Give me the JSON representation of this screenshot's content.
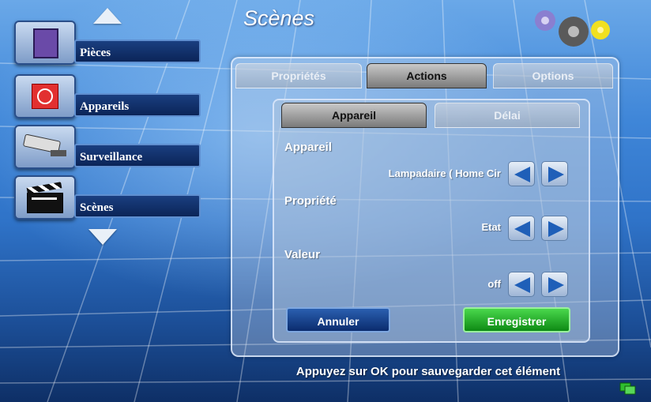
{
  "header": {
    "title": "Scènes"
  },
  "sidebar": {
    "items": [
      {
        "label": "Pièces",
        "icon": "door-icon"
      },
      {
        "label": "Appareils",
        "icon": "power-box-icon"
      },
      {
        "label": "Surveillance",
        "icon": "camera-icon"
      },
      {
        "label": "Scènes",
        "icon": "clapperboard-icon"
      }
    ]
  },
  "panel": {
    "tabs": [
      {
        "label": "Propriétés",
        "active": false
      },
      {
        "label": "Actions",
        "active": true
      },
      {
        "label": "Options",
        "active": false
      }
    ],
    "subtabs": [
      {
        "label": "Appareil",
        "active": true
      },
      {
        "label": "Délai",
        "active": false
      }
    ],
    "fields": [
      {
        "label": "Appareil",
        "value": "Lampadaire ( Home Cir"
      },
      {
        "label": "Propriété",
        "value": "Etat"
      },
      {
        "label": "Valeur",
        "value": "off"
      }
    ],
    "cancel_label": "Annuler",
    "save_label": "Enregistrer"
  },
  "footer": {
    "hint": "Appuyez sur OK pour sauvegarder cet élément"
  },
  "colors": {
    "accent": "#1f5fb8",
    "save": "#1aa51f",
    "cancel": "#0b2c6e"
  }
}
